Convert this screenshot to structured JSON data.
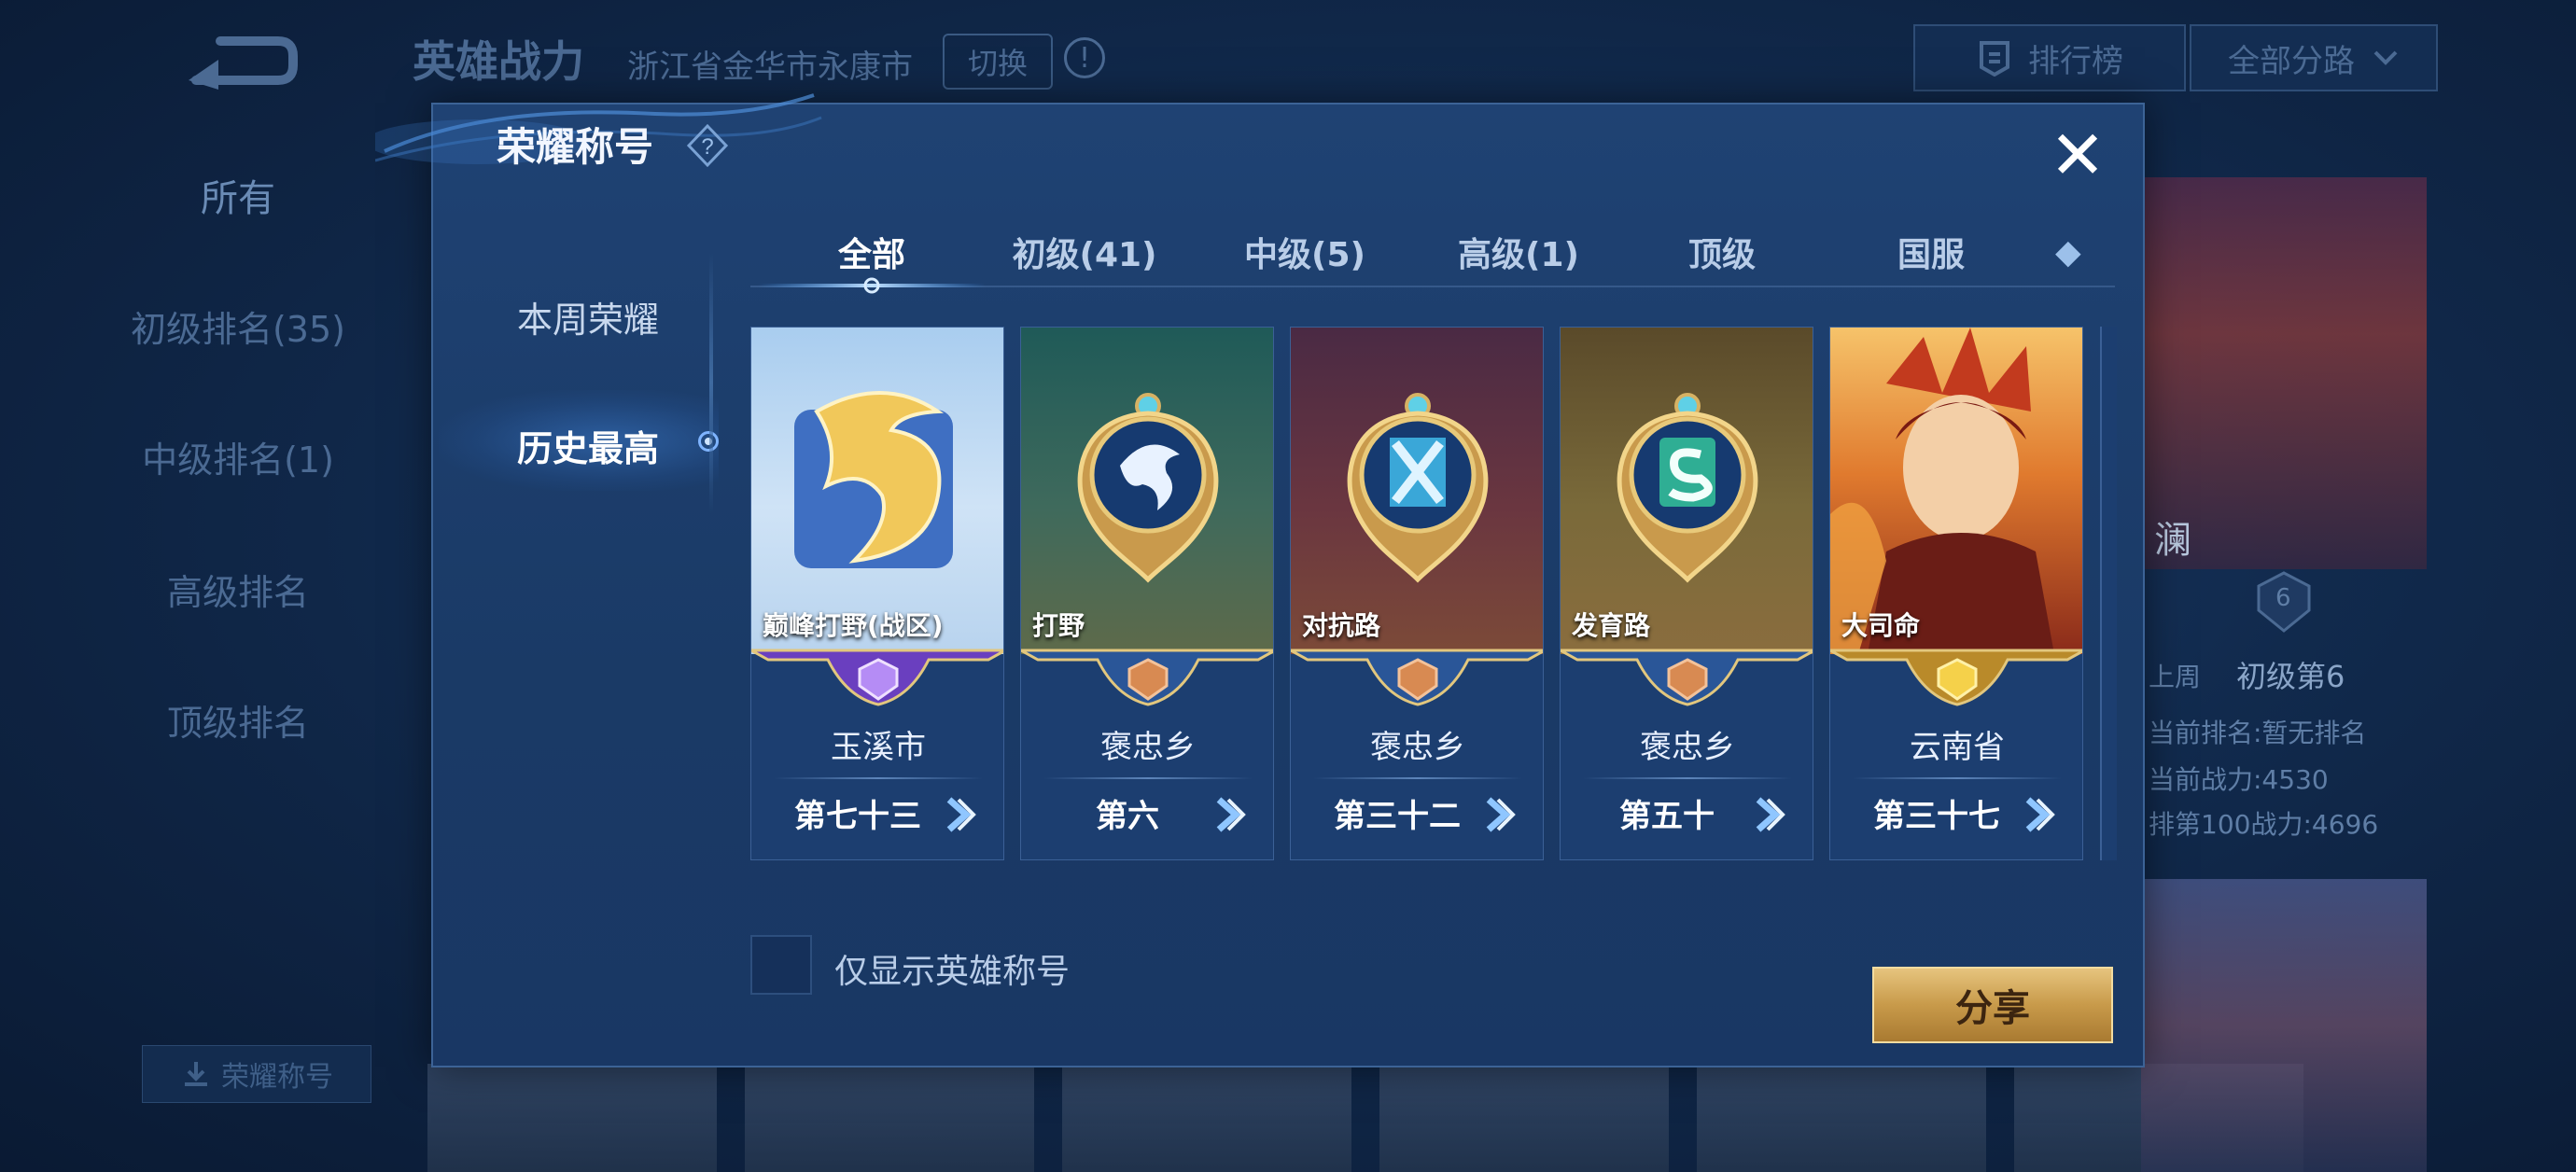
{
  "background": {
    "header_title": "英雄战力",
    "header_location": "浙江省金华市永康市",
    "switch_label": "切换",
    "info_glyph": "!",
    "leaderboard_label": "排行榜",
    "route_filter_label": "全部分路",
    "sidebar": [
      {
        "label": "所有"
      },
      {
        "label": "初级排名(35)"
      },
      {
        "label": "中级排名(1)"
      },
      {
        "label": "高级排名"
      },
      {
        "label": "顶级排名"
      }
    ],
    "honor_button_label": "荣耀称号",
    "right_card": {
      "hero_name": "澜",
      "badge_number": "6",
      "last_week_label": "上周",
      "last_week_value": "初级第6",
      "current_rank": "当前排名:暂无排名",
      "current_power": "当前战力:4530",
      "top100_power": "排第100战力:4696"
    }
  },
  "modal": {
    "title": "荣耀称号",
    "help_glyph": "?",
    "close_glyph": "✕",
    "side_tabs": [
      {
        "label": "本周荣耀",
        "active": false
      },
      {
        "label": "历史最高",
        "active": true
      }
    ],
    "tabs": [
      {
        "label": "全部",
        "active": true
      },
      {
        "label": "初级(41)",
        "active": false
      },
      {
        "label": "中级(5)",
        "active": false
      },
      {
        "label": "高级(1)",
        "active": false
      },
      {
        "label": "顶级",
        "active": false
      },
      {
        "label": "国服",
        "active": false
      },
      {
        "label": "◆",
        "active": false
      }
    ],
    "cards": [
      {
        "name": "巅峰打野(战区)",
        "region": "玉溪市",
        "rank": "第七十三",
        "tier": "peak",
        "art": "dragon-logo"
      },
      {
        "name": "打野",
        "region": "褒忠乡",
        "rank": "第六",
        "tier": "bronze",
        "art": "jungle-emblem"
      },
      {
        "name": "对抗路",
        "region": "褒忠乡",
        "rank": "第三十二",
        "tier": "bronze",
        "art": "clash-emblem"
      },
      {
        "name": "发育路",
        "region": "褒忠乡",
        "rank": "第五十",
        "tier": "bronze",
        "art": "farm-emblem"
      },
      {
        "name": "大司命",
        "region": "云南省",
        "rank": "第三十七",
        "tier": "gold",
        "art": "hero-portrait"
      }
    ],
    "checkbox_label": "仅显示英雄称号",
    "checkbox_checked": false,
    "share_label": "分享"
  },
  "colors": {
    "accent_blue": "#7fb4ff",
    "gold": "#e2b866",
    "bronze": "#c97a45",
    "purple": "#8a5bd6"
  }
}
